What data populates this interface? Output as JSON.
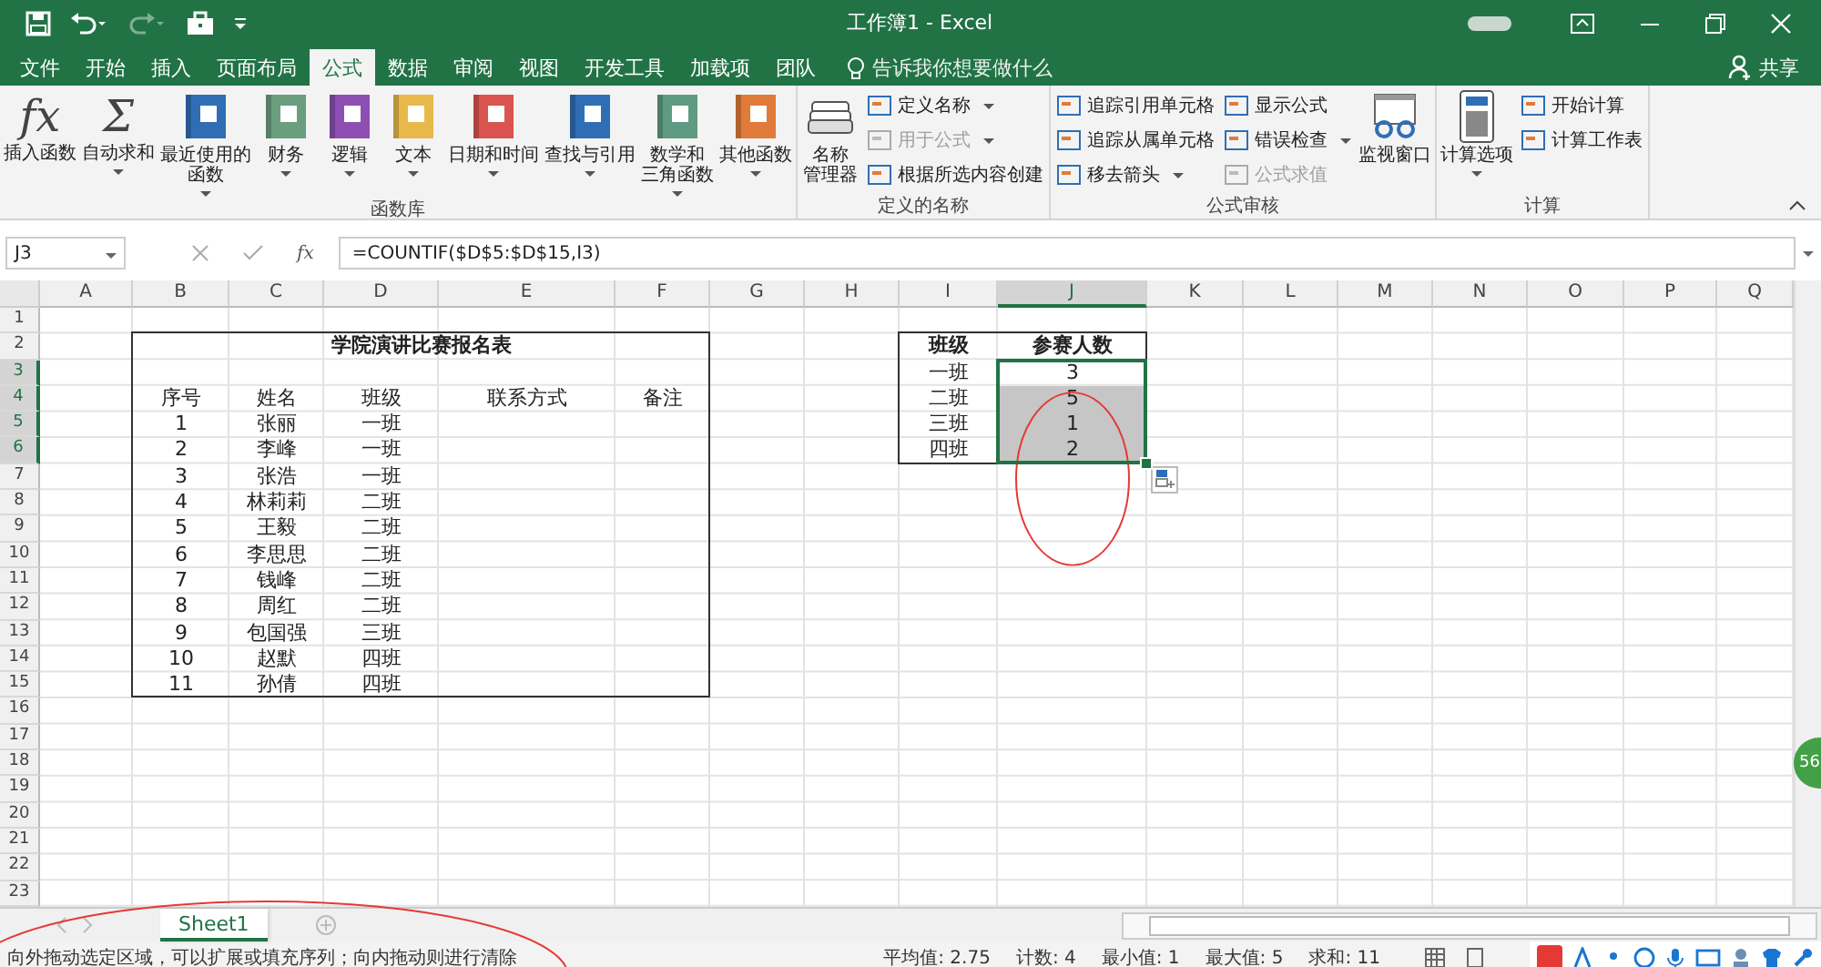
{
  "window": {
    "title": "工作簿1  -  Excel"
  },
  "tabs": [
    {
      "label": "文件",
      "selected": false
    },
    {
      "label": "开始",
      "selected": false
    },
    {
      "label": "插入",
      "selected": false
    },
    {
      "label": "页面布局",
      "selected": false
    },
    {
      "label": "公式",
      "selected": true
    },
    {
      "label": "数据",
      "selected": false
    },
    {
      "label": "审阅",
      "selected": false
    },
    {
      "label": "视图",
      "selected": false
    },
    {
      "label": "开发工具",
      "selected": false
    },
    {
      "label": "加载项",
      "selected": false
    },
    {
      "label": "团队",
      "selected": false
    }
  ],
  "tell_me": {
    "placeholder": "告诉我你想要做什么"
  },
  "share": "共享",
  "ribbon_groups": [
    {
      "label": "函数库",
      "items": [
        {
          "kind": "large",
          "lines": [
            "插入函数"
          ],
          "glyph": "fx",
          "dropdown": false,
          "disabled": false
        },
        {
          "kind": "large",
          "lines": [
            "自动求和"
          ],
          "glyph": "Σ",
          "dropdown": true,
          "disabled": false
        },
        {
          "kind": "large",
          "lines": [
            "最近使用的",
            "函数"
          ],
          "dropdown": true,
          "disabled": false
        },
        {
          "kind": "large",
          "lines": [
            "财务"
          ],
          "dropdown": true,
          "disabled": false
        },
        {
          "kind": "large",
          "lines": [
            "逻辑"
          ],
          "dropdown": true,
          "disabled": false
        },
        {
          "kind": "large",
          "lines": [
            "文本"
          ],
          "dropdown": true,
          "disabled": false
        },
        {
          "kind": "large",
          "lines": [
            "日期和时间"
          ],
          "dropdown": true,
          "disabled": false
        },
        {
          "kind": "large",
          "lines": [
            "查找与引用"
          ],
          "dropdown": true,
          "disabled": false
        },
        {
          "kind": "large",
          "lines": [
            "数学和",
            "三角函数"
          ],
          "dropdown": true,
          "disabled": false
        },
        {
          "kind": "large",
          "lines": [
            "其他函数"
          ],
          "dropdown": true,
          "disabled": false
        }
      ]
    },
    {
      "label": "定义的名称",
      "items": [
        {
          "kind": "large",
          "lines": [
            "名称",
            "管理器"
          ],
          "dropdown": false,
          "disabled": false
        },
        {
          "kind": "small",
          "lines": [
            "定义名称"
          ],
          "dropdown": true,
          "disabled": false
        },
        {
          "kind": "small",
          "lines": [
            "用于公式"
          ],
          "dropdown": true,
          "disabled": true
        },
        {
          "kind": "small",
          "lines": [
            "根据所选内容创建"
          ],
          "dropdown": false,
          "disabled": false
        }
      ]
    },
    {
      "label": "公式审核",
      "items": [
        {
          "kind": "small",
          "lines": [
            "追踪引用单元格"
          ],
          "dropdown": false,
          "disabled": false
        },
        {
          "kind": "small",
          "lines": [
            "追踪从属单元格"
          ],
          "dropdown": false,
          "disabled": false
        },
        {
          "kind": "small",
          "lines": [
            "移去箭头"
          ],
          "dropdown": true,
          "disabled": false
        },
        {
          "kind": "small",
          "lines": [
            "显示公式"
          ],
          "dropdown": false,
          "disabled": false
        },
        {
          "kind": "small",
          "lines": [
            "错误检查"
          ],
          "dropdown": true,
          "disabled": false
        },
        {
          "kind": "small",
          "lines": [
            "公式求值"
          ],
          "dropdown": false,
          "disabled": true
        },
        {
          "kind": "large",
          "lines": [
            "监视窗口"
          ],
          "dropdown": false,
          "disabled": false
        }
      ]
    },
    {
      "label": "计算",
      "items": [
        {
          "kind": "large",
          "lines": [
            "计算选项"
          ],
          "dropdown": true,
          "disabled": false
        },
        {
          "kind": "small",
          "lines": [
            "开始计算"
          ],
          "dropdown": false,
          "disabled": false
        },
        {
          "kind": "small",
          "lines": [
            "计算工作表"
          ],
          "dropdown": false,
          "disabled": false
        }
      ]
    }
  ],
  "formula_bar": {
    "name_box": "J3",
    "fx": "fx",
    "formula": "=COUNTIF($D$5:$D$15,I3)"
  },
  "columns": [
    {
      "label": "A",
      "selected": false
    },
    {
      "label": "B",
      "selected": false
    },
    {
      "label": "C",
      "selected": false
    },
    {
      "label": "D",
      "selected": false
    },
    {
      "label": "E",
      "selected": false
    },
    {
      "label": "F",
      "selected": false
    },
    {
      "label": "G",
      "selected": false
    },
    {
      "label": "H",
      "selected": false
    },
    {
      "label": "I",
      "selected": false
    },
    {
      "label": "J",
      "selected": true
    },
    {
      "label": "K",
      "selected": false
    },
    {
      "label": "L",
      "selected": false
    },
    {
      "label": "M",
      "selected": false
    },
    {
      "label": "N",
      "selected": false
    },
    {
      "label": "O",
      "selected": false
    },
    {
      "label": "P",
      "selected": false
    },
    {
      "label": "Q",
      "selected": false
    }
  ],
  "rows": [
    {
      "label": "1",
      "selected": false
    },
    {
      "label": "2",
      "selected": false
    },
    {
      "label": "3",
      "selected": true
    },
    {
      "label": "4",
      "selected": true
    },
    {
      "label": "5",
      "selected": true
    },
    {
      "label": "6",
      "selected": true
    },
    {
      "label": "7",
      "selected": false
    },
    {
      "label": "8",
      "selected": false
    },
    {
      "label": "9",
      "selected": false
    },
    {
      "label": "10",
      "selected": false
    },
    {
      "label": "11",
      "selected": false
    },
    {
      "label": "12",
      "selected": false
    },
    {
      "label": "13",
      "selected": false
    },
    {
      "label": "14",
      "selected": false
    },
    {
      "label": "15",
      "selected": false
    },
    {
      "label": "16",
      "selected": false
    },
    {
      "label": "17",
      "selected": false
    },
    {
      "label": "18",
      "selected": false
    },
    {
      "label": "19",
      "selected": false
    },
    {
      "label": "20",
      "selected": false
    },
    {
      "label": "21",
      "selected": false
    },
    {
      "label": "22",
      "selected": false
    },
    {
      "label": "23",
      "selected": false
    }
  ],
  "registration_table": {
    "title": "学院演讲比赛报名表",
    "headers": [
      "序号",
      "姓名",
      "班级",
      "联系方式",
      "备注"
    ],
    "rows": [
      [
        "1",
        "张丽",
        "一班"
      ],
      [
        "2",
        "李峰",
        "一班"
      ],
      [
        "3",
        "张浩",
        "一班"
      ],
      [
        "4",
        "林莉莉",
        "二班"
      ],
      [
        "5",
        "王毅",
        "二班"
      ],
      [
        "6",
        "李思思",
        "二班"
      ],
      [
        "7",
        "钱峰",
        "二班"
      ],
      [
        "8",
        "周红",
        "二班"
      ],
      [
        "9",
        "包国强",
        "三班"
      ],
      [
        "10",
        "赵默",
        "四班"
      ],
      [
        "11",
        "孙倩",
        "四班"
      ]
    ]
  },
  "summary_table": {
    "headers": [
      "班级",
      "参赛人数"
    ],
    "rows": [
      {
        "class": "一班",
        "count": "3",
        "selected": true
      },
      {
        "class": "二班",
        "count": "5",
        "selected": true
      },
      {
        "class": "三班",
        "count": "1",
        "selected": true
      },
      {
        "class": "四班",
        "count": "2",
        "selected": true
      }
    ]
  },
  "floating_badge": "56",
  "sheet_tabs": [
    {
      "label": "Sheet1",
      "selected": true
    }
  ],
  "status_bar": {
    "message": "向外拖动选定区域，可以扩展或填充序列；向内拖动则进行清除",
    "stats": [
      "平均值: 2.75",
      "计数: 4",
      "最小值: 1",
      "最大值: 5",
      "求和: 11"
    ]
  }
}
